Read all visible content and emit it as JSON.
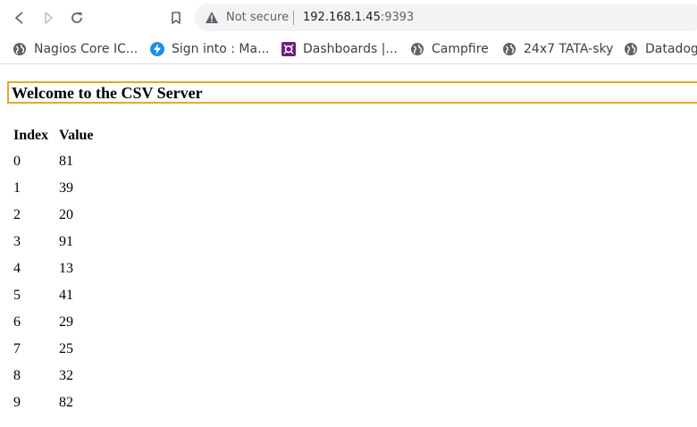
{
  "toolbar": {
    "back_icon": "back-arrow-icon",
    "forward_icon": "forward-arrow-icon",
    "reload_icon": "reload-icon",
    "bookmark_icon": "bookmark-star-icon",
    "security_label": "Not secure",
    "url_host": "192.168.1.45",
    "url_port": ":9393"
  },
  "bookmarks": [
    {
      "label": "Nagios Core IC...",
      "icon": "globe-icon"
    },
    {
      "label": "Sign into : Ma...",
      "icon": "lightning-icon"
    },
    {
      "label": "Dashboards |...",
      "icon": "grafana-icon"
    },
    {
      "label": "Campfire",
      "icon": "globe-icon"
    },
    {
      "label": "24x7 TATA-sky",
      "icon": "globe-icon"
    },
    {
      "label": "Datadog",
      "icon": "globe-icon"
    }
  ],
  "page": {
    "heading": "Welcome to the CSV Server",
    "columns": [
      "Index",
      "Value"
    ],
    "rows": [
      [
        "0",
        "81"
      ],
      [
        "1",
        "39"
      ],
      [
        "2",
        "20"
      ],
      [
        "3",
        "91"
      ],
      [
        "4",
        "13"
      ],
      [
        "5",
        "41"
      ],
      [
        "6",
        "29"
      ],
      [
        "7",
        "25"
      ],
      [
        "8",
        "32"
      ],
      [
        "9",
        "82"
      ]
    ]
  },
  "colors": {
    "heading_border": "#e8a921",
    "omnibox_bg": "#f1f3f4",
    "lightning_bg": "#1a8fe3",
    "grafana_bg": "#6b1f7c"
  }
}
